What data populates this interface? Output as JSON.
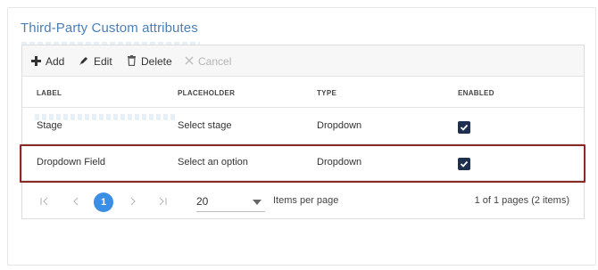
{
  "title": "Third-Party Custom attributes",
  "toolbar": {
    "add_label": "Add",
    "edit_label": "Edit",
    "delete_label": "Delete",
    "cancel_label": "Cancel"
  },
  "columns": {
    "label": "LABEL",
    "placeholder": "PLACEHOLDER",
    "type": "TYPE",
    "enabled": "ENABLED"
  },
  "rows": [
    {
      "label": "Stage",
      "placeholder": "Select stage",
      "type": "Dropdown",
      "enabled": true
    },
    {
      "label": "Dropdown Field",
      "placeholder": "Select an option",
      "type": "Dropdown",
      "enabled": true,
      "selected": true
    }
  ],
  "pager": {
    "current_page": "1",
    "page_size": "20",
    "items_per_page_label": "Items per page",
    "info": "1 of 1 pages (2 items)"
  },
  "colors": {
    "title": "#4a7fb8",
    "checkbox": "#1f2f4e",
    "selected_outline": "#8a2a26",
    "pager_active": "#3a8ee6"
  },
  "icons": {
    "add": "plus-icon",
    "edit": "pencil-icon",
    "delete": "trash-icon",
    "cancel": "close-icon",
    "first": "first-page-icon",
    "prev": "prev-page-icon",
    "next": "next-page-icon",
    "last": "last-page-icon"
  }
}
